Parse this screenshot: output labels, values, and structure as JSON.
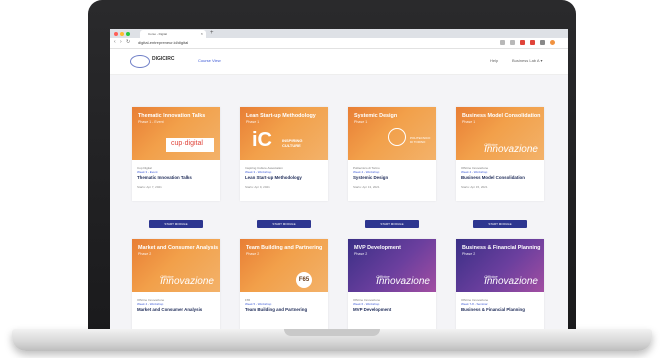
{
  "browser": {
    "tab_title": "Corso - Digital",
    "url": "digital-entrepreneur.id/digital",
    "new_tab_symbol": "+",
    "tab_close_symbol": "×",
    "back_icon": "back-arrow-icon",
    "forward_icon": "forward-arrow-icon",
    "reload_icon": "reload-icon"
  },
  "header": {
    "logo_text": "DIGICIRC",
    "nav_link": "Course View",
    "right_link": "Help",
    "user_menu": "Business Lab A",
    "user_menu_chevron": "▾"
  },
  "cards": [
    {
      "thumb_title": "Thematic Innovation Talks",
      "thumb_phase": "Phase 1 - Event",
      "org": "Cup Digital",
      "week": "Week 3 - Event",
      "title": "Thematic Innovation Talks",
      "date": "Starts: Apr 7, 2021",
      "logo": "cup·digital",
      "theme": "orange"
    },
    {
      "thumb_title": "Lean Start-up Methodology",
      "thumb_phase": "Phase 1",
      "org": "Inspiring Culture Association",
      "week": "Week 3 - Workshop",
      "title": "Lean Start-up Methodology",
      "date": "Starts: Apr 9, 2021",
      "logo_big": "iC",
      "logo_small": "INSPIRING\nCULTURE",
      "theme": "orange"
    },
    {
      "thumb_title": "Systemic Design",
      "thumb_phase": "Phase 1",
      "org": "Politecnico di Torino",
      "week": "Week 4 - Workshop",
      "title": "Systemic Design",
      "date": "Starts: Apr 13, 2021",
      "logo_small": "POLITECNICO\nDI TORINO",
      "theme": "orange"
    },
    {
      "thumb_title": "Business Model Consolidation",
      "thumb_phase": "Phase 1",
      "org": "Officine Innovazione",
      "week": "Week 4 - Workshop",
      "title": "Business Model Consolidation",
      "date": "Starts: Apr 15, 2021",
      "logo_small": "Officine",
      "logo_big": "Innovazione",
      "theme": "orange"
    },
    {
      "thumb_title": "Market and Consumer Analysis",
      "thumb_phase": "Phase 2",
      "org": "Officine Innovazione",
      "week": "Week 4 - Workshop",
      "title": "Market and Consumer Analysis",
      "logo_small": "Officine",
      "logo_big": "Innovazione",
      "theme": "orange"
    },
    {
      "thumb_title": "Team Building and Partnering",
      "thumb_phase": "Phase 2",
      "org": "F65",
      "week": "Week 5 - Workshop",
      "title": "Team Building and Partnering",
      "logo": "F65",
      "theme": "orange"
    },
    {
      "thumb_title": "MVP Development",
      "thumb_phase": "Phase 2",
      "org": "Officine Innovazione",
      "week": "Week 6 - Workshop",
      "title": "MVP Development",
      "logo_small": "Officine",
      "logo_big": "Innovazione",
      "theme": "purple"
    },
    {
      "thumb_title": "Business & Financial Planning",
      "thumb_phase": "Phase 2",
      "org": "Officine Innovazione",
      "week": "Week 7-8 - Seminar",
      "title": "Business & Financial Planning",
      "logo_small": "Officine",
      "logo_big": "Innovazione",
      "theme": "purple"
    }
  ],
  "start_button_label": "START MODULE",
  "colors": {
    "accent": "#2d3690",
    "orange": "#f0923f",
    "purple": "#4a3a92"
  }
}
